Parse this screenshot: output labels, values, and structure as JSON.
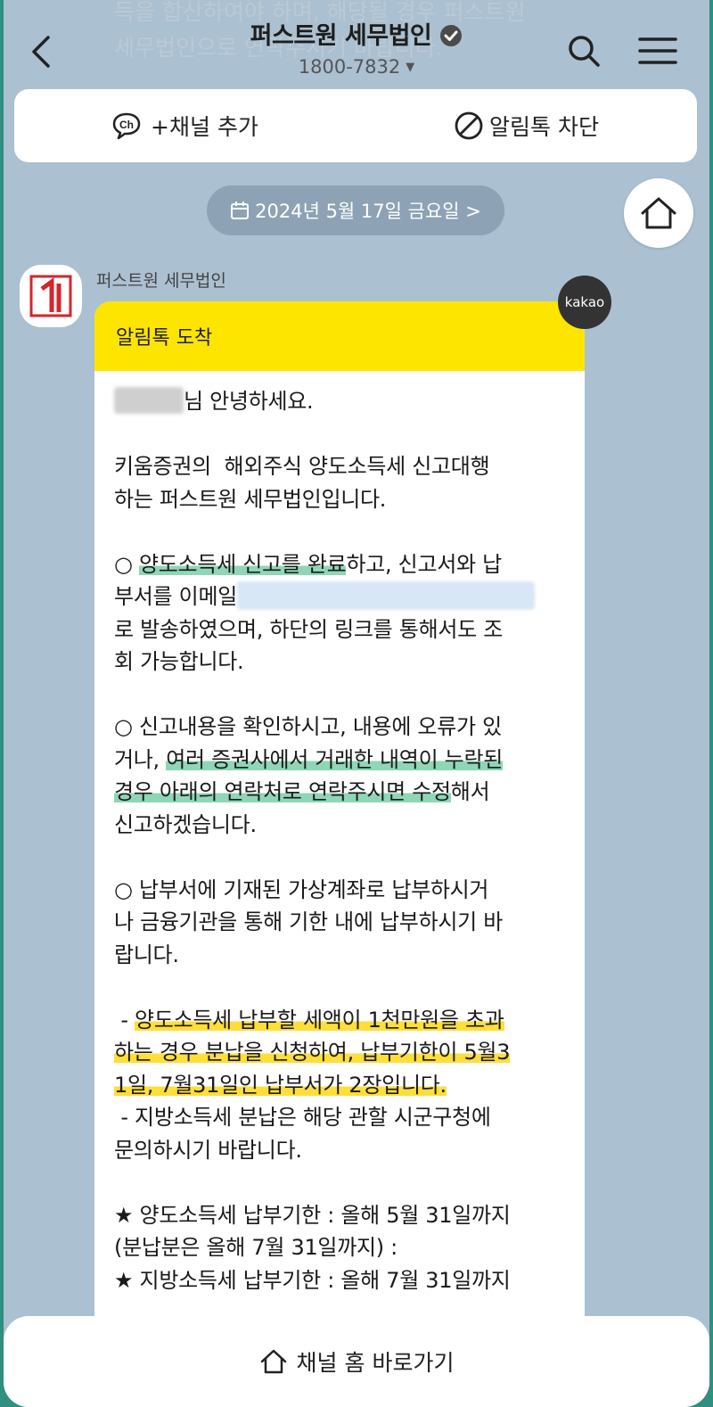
{
  "header": {
    "ghost_line_1": "득을 합산하여야 하며, 해당될 경우 퍼스트원",
    "ghost_line_2": "세무법인으로 연락주시기 바랍니다.",
    "title": "퍼스트원 세무법인",
    "phone": "1800-7832"
  },
  "actions": {
    "add_channel": "+채널 추가",
    "block_alimtalk": "알림톡 차단"
  },
  "date_pill": "2024년 5월 17일 금요일 >",
  "sender_name": "퍼스트원 세무법인",
  "kakao_badge": "kakao",
  "message": {
    "head": "알림톡 도착",
    "greeting": "님 안녕하세요.",
    "intro": "키움증권의  해외주식 양도소득세 신고대행\n하는 퍼스트원 세무법인입니다.",
    "p1_prefix": "○ ",
    "p1_highlight": "양도소득세 신고를 완료",
    "p1_mid": "하고, 신고서와 납\n부서를 이메일",
    "p1_suffix": "\n로 발송하였으며, 하단의 링크를 통해서도 조\n회 가능합니다.",
    "p2_prefix": "○ 신고내용을 확인하시고, 내용에 오류가 있\n거나, ",
    "p2_highlight": "여러 증권사에서 거래한 내역이 누락된\n경우 아래의 연락처로 연락주시면 수정",
    "p2_suffix": "해서\n신고하겠습니다.",
    "p3": "○ 납부서에 기재된 가상계좌로 납부하시거\n나 금융기관을 통해 기한 내에 납부하시기 바\n랍니다.",
    "p4_prefix": " - ",
    "p4_highlight": "양도소득세 납부할 세액이 1천만원을 초과\n하는 경우 분납을 신청하여, 납부기한이 5월3\n1일, 7월31일인 납부서가 2장입니다.",
    "p4_suffix": "\n - 지방소득세 분납은 해당 관할 시군구청에\n문의하시기 바랍니다.",
    "p5": "★ 양도소득세 납부기한 : 올해 5월 31일까지\n(분납분은 올해 7월 31일까지) :\n★ 지방소득세 납부기한 : 올해 7월 31일까지"
  },
  "footer": {
    "label": "채널 홈 바로가기"
  },
  "colors": {
    "background": "#abc0d1",
    "alimtalk_yellow": "#fee500",
    "highlight_green": "#8fd6b6",
    "highlight_yellow": "#ffde3a"
  },
  "icons": [
    "back-icon",
    "verified-icon",
    "search-icon",
    "menu-icon",
    "channel-add-icon",
    "block-icon",
    "calendar-icon",
    "home-icon",
    "logo-icon"
  ]
}
